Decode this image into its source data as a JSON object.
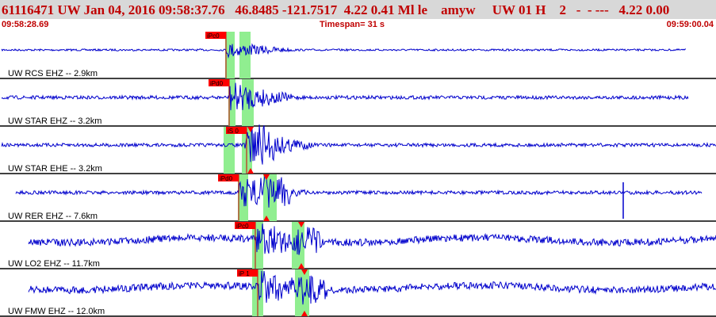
{
  "header": {
    "event_line": "61116471 UW Jan 04, 2016 09:58:37.76   46.8485 -121.7517  4.22 0.41 Ml le    amyw     UW 01 H    2   -  - ---   4.22 0.00",
    "start_time": "09:58:28.69",
    "timespan": "Timespan=  31 s",
    "end_time": "09:59:00.04"
  },
  "colors": {
    "header_bg": "#d8d8d8",
    "header_text": "#c00000",
    "trace": "#0000cc",
    "pick_window": "#90ee90",
    "pick_flag": "#ff0000",
    "pick_line": "#cc0000",
    "separator": "#000000"
  },
  "traces": [
    {
      "label": "UW RCS EHZ -- 2.9km",
      "pick_label": "iPc0",
      "has_s_pick": false,
      "amplitude": "small"
    },
    {
      "label": "UW STAR EHZ -- 3.2km",
      "pick_label": "iPd0",
      "has_s_pick": false,
      "amplitude": "medium"
    },
    {
      "label": "UW STAR EHE -- 3.2km",
      "pick_label": "iS 0",
      "has_s_pick": true,
      "amplitude": "medium"
    },
    {
      "label": "UW RER EHZ -- 7.6km",
      "pick_label": "iPd0",
      "has_s_pick": true,
      "amplitude": "medium"
    },
    {
      "label": "UW LO2 EHZ -- 11.7km",
      "pick_label": "iPc0",
      "has_s_pick": true,
      "amplitude": "large"
    },
    {
      "label": "UW FMW EHZ -- 12.0km",
      "pick_label": "iP 1",
      "has_s_pick": true,
      "amplitude": "large"
    }
  ]
}
